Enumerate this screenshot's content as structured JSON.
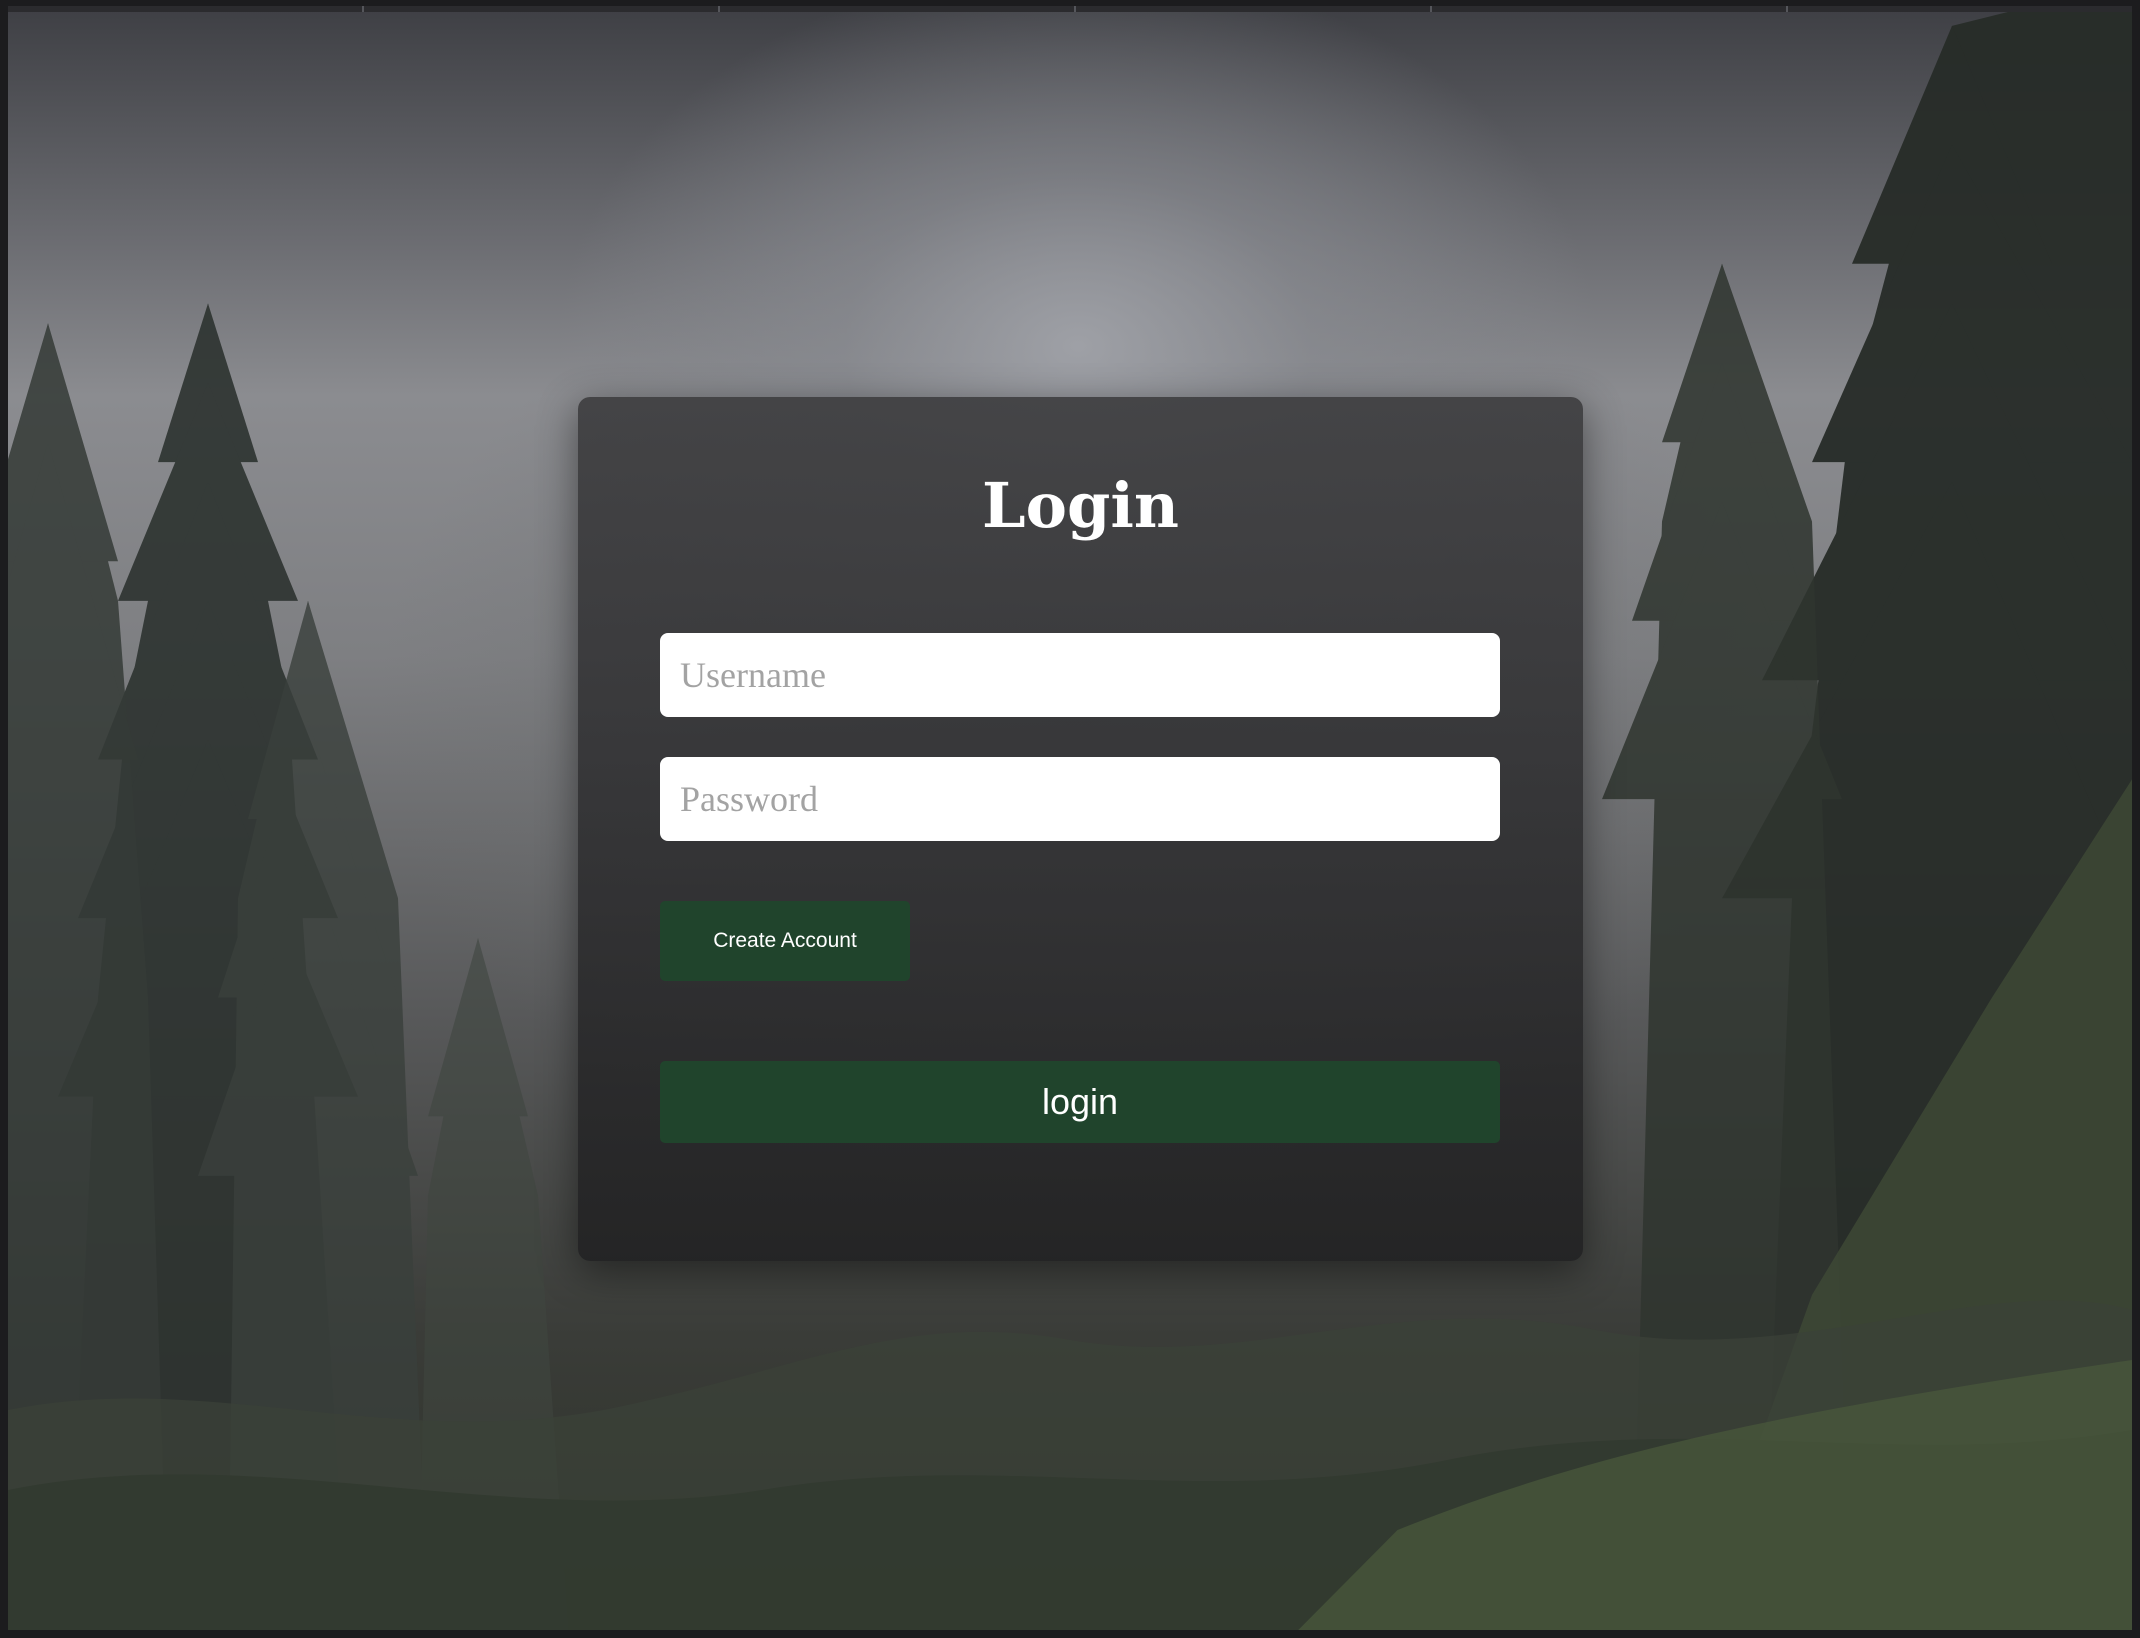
{
  "login_form": {
    "title": "Login",
    "username_placeholder": "Username",
    "password_placeholder": "Password",
    "create_account_label": "Create Account",
    "login_label": "login"
  },
  "colors": {
    "button_green": "#20442c",
    "input_background": "#ffffff",
    "title_text": "#ffffff",
    "placeholder_text": "#a3a3a3"
  },
  "background": {
    "description_icon": "misty-forest-image"
  }
}
